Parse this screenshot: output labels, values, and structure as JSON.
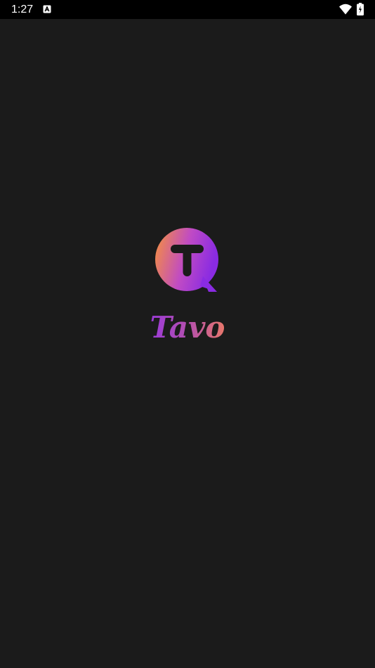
{
  "status_bar": {
    "time": "1:27",
    "notification_icon": "a-box-icon",
    "wifi_icon": "wifi-icon",
    "battery_icon": "battery-charging-icon"
  },
  "splash": {
    "app_name": "Tavo",
    "logo_icon": "chat-bubble-t-logo",
    "colors": {
      "background": "#1b1b1b",
      "gradient_orange": "#f7923a",
      "gradient_purple": "#8a2be2",
      "text_purple": "#9b3bd8",
      "text_coral": "#e8776a"
    }
  }
}
